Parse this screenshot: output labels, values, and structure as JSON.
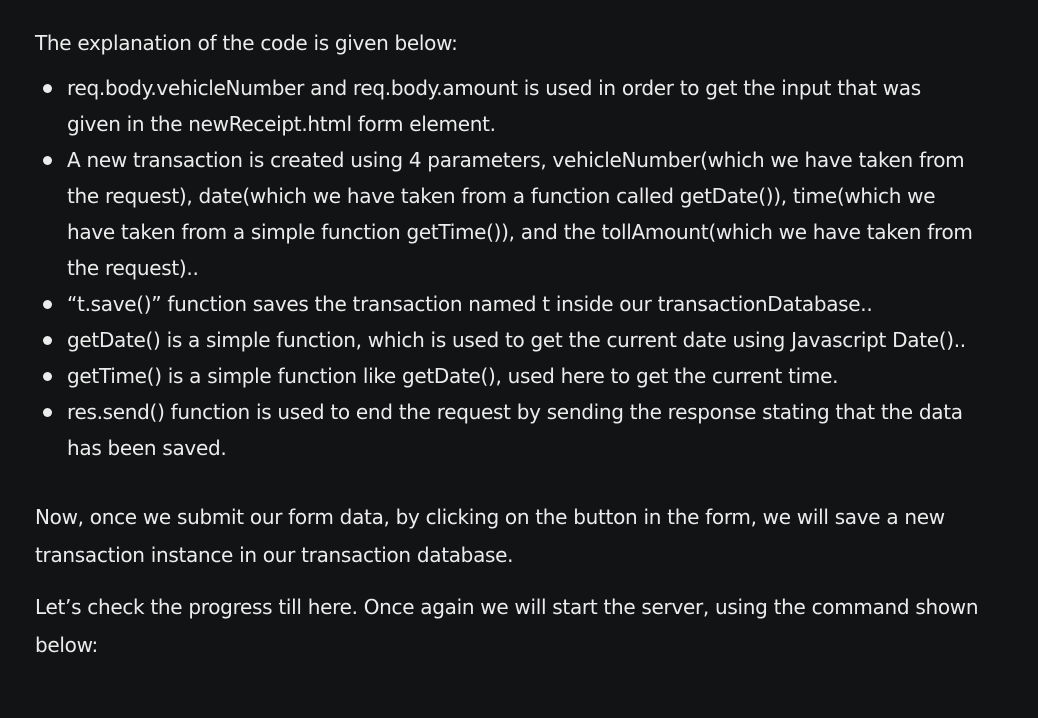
{
  "intro": "The explanation of the code is given below:",
  "bullets": [
    "req.body.vehicleNumber and req.body.amount is used in order to get the input that was given in the newReceipt.html form element.",
    "A new transaction is created using 4 parameters, vehicleNumber(which we have taken from the request), date(which we have taken from a function called getDate()), time(which we have taken from a simple function getTime()), and the tollAmount(which we have taken from the request)..",
    "“t.save()” function saves the transaction named t inside our transactionDatabase..",
    "getDate() is a simple function, which is used to get the current date using Javascript Date()..",
    "getTime() is a simple function like getDate(), used here to get the current time.",
    "res.send() function is used to end the request by sending the response stating that the data has been saved."
  ],
  "paragraph_submit": "Now, once we submit our form data, by clicking on the button in the form, we will save a new transaction instance in our transaction database.",
  "paragraph_progress": "Let’s check the progress till here. Once again we will start the server, using the command shown below:"
}
